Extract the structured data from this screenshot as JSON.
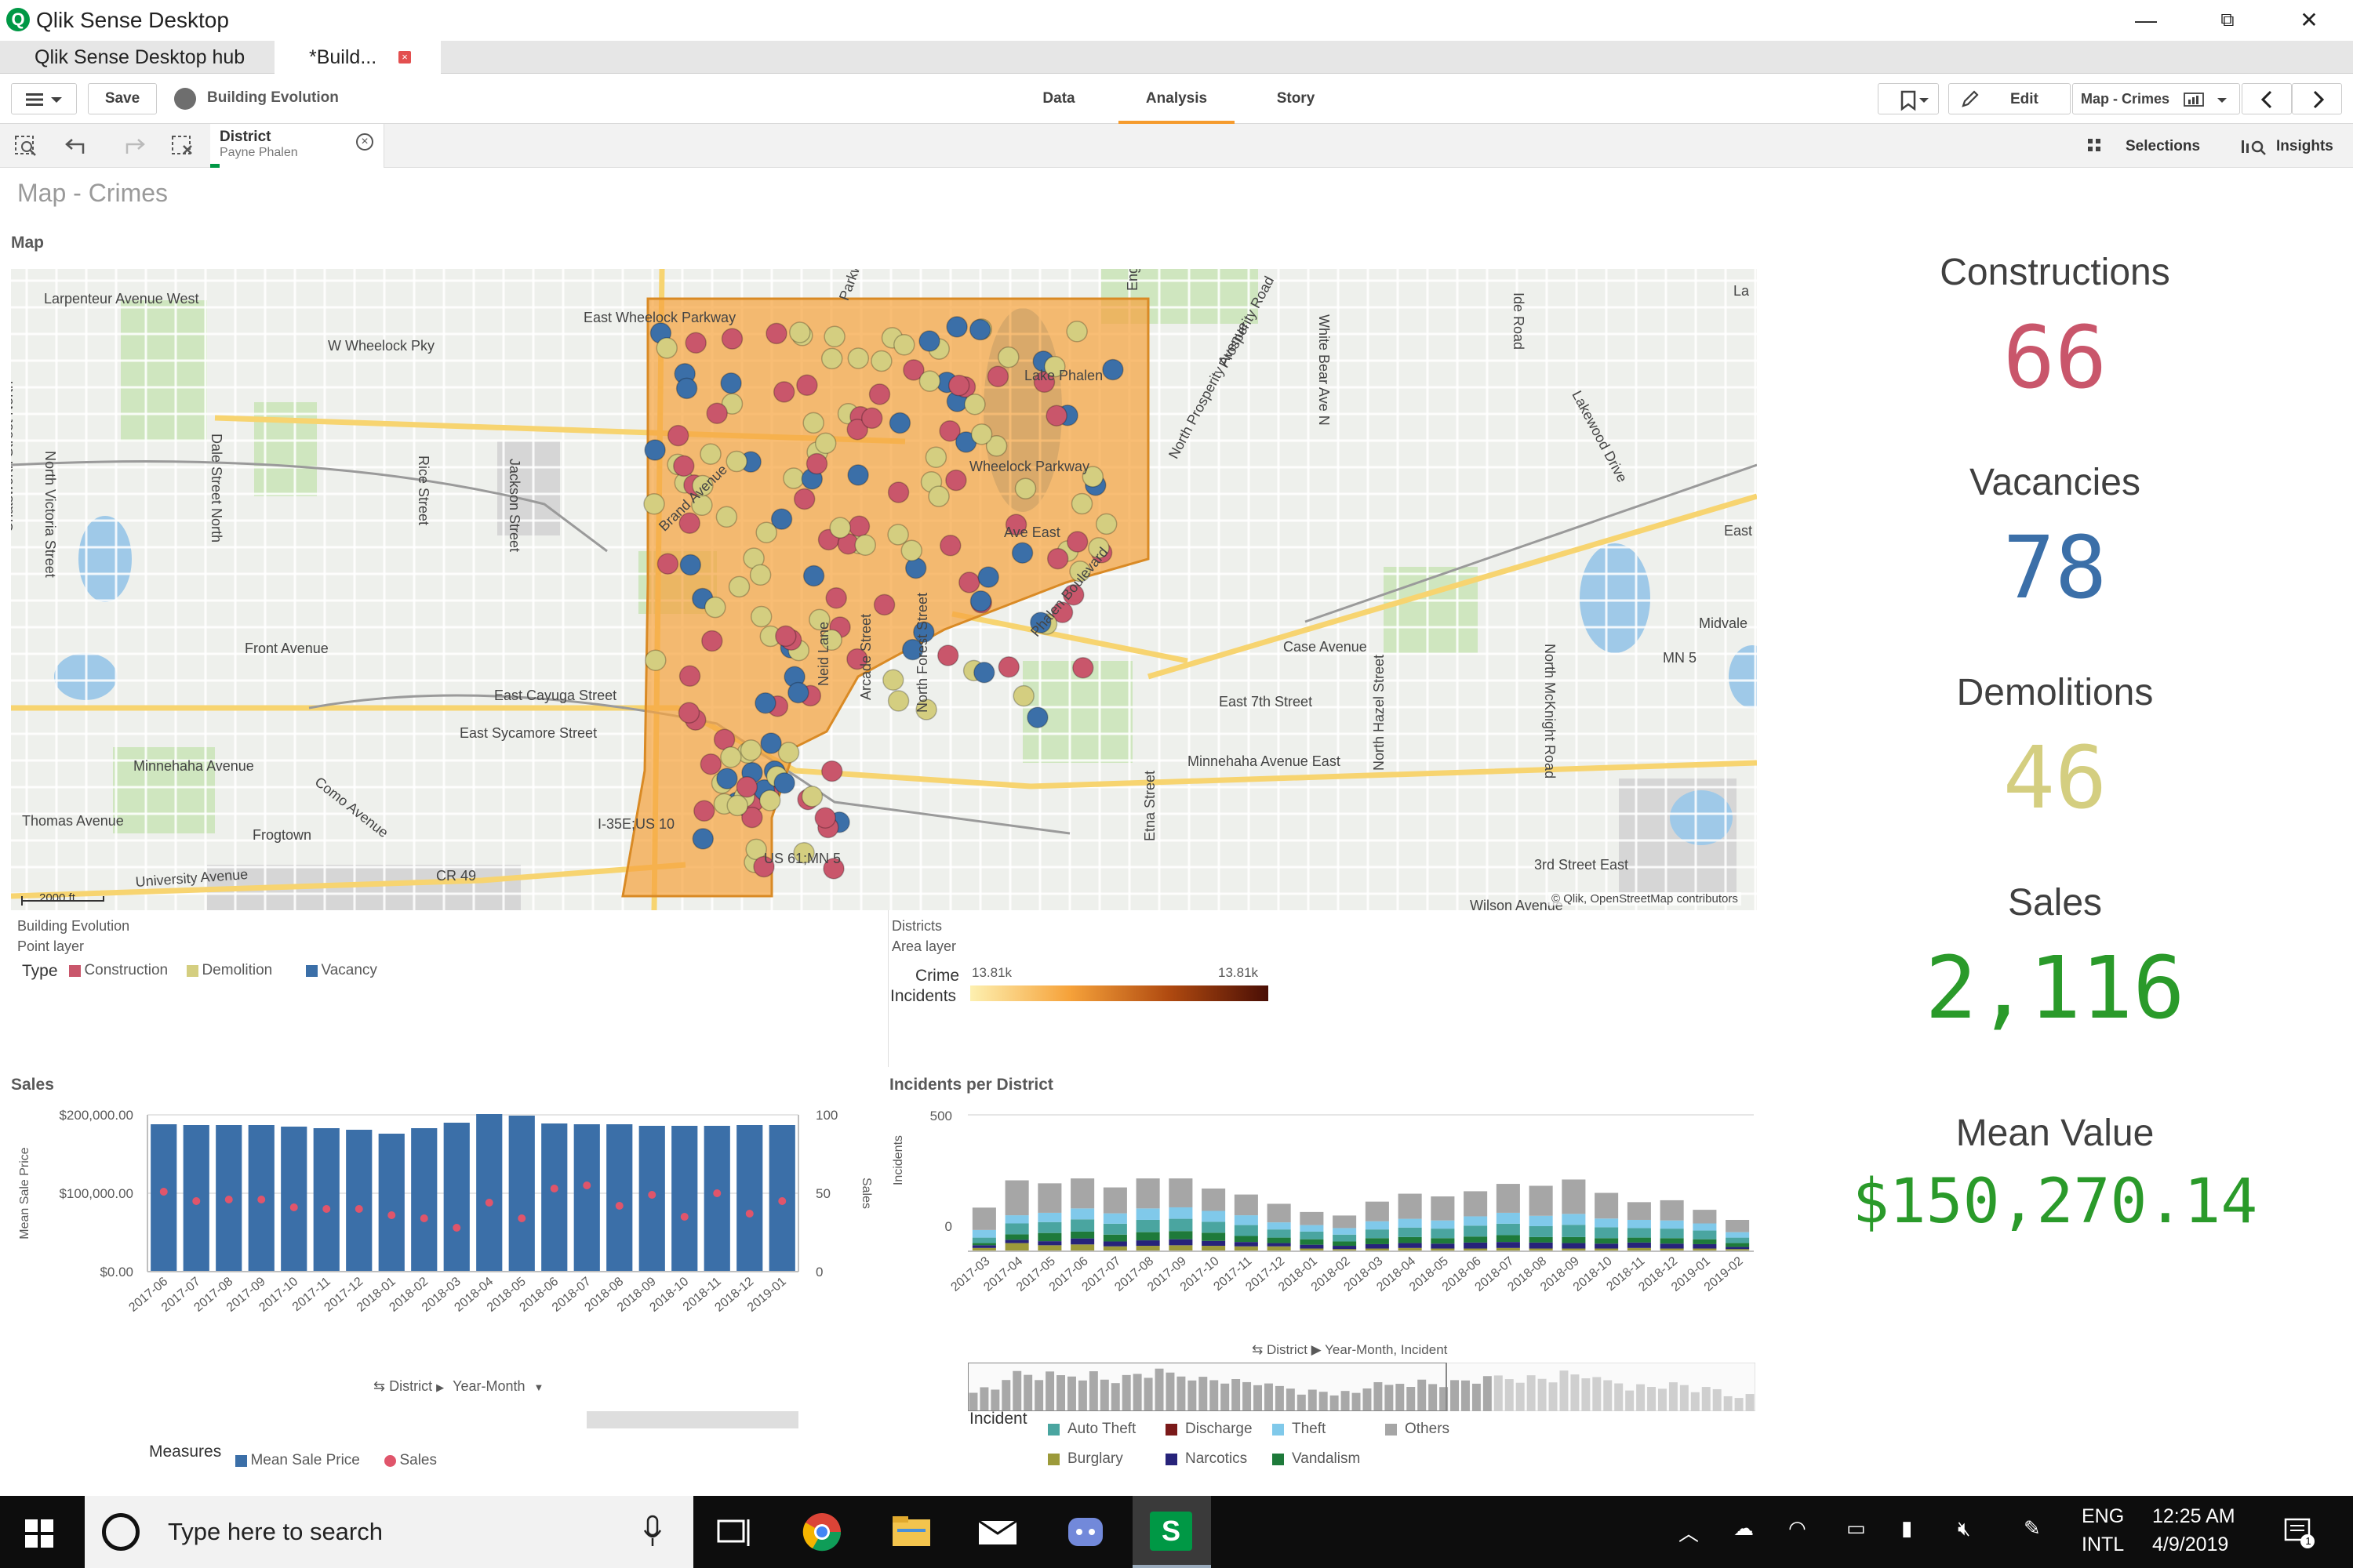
{
  "window": {
    "title": "Qlik Sense Desktop",
    "minimize": "—",
    "restore": "⧉",
    "close": "✕"
  },
  "tabs": [
    {
      "label": "Qlik Sense Desktop hub"
    },
    {
      "label": "*Build..."
    }
  ],
  "toolbar": {
    "save_label": "Save",
    "app_name": "Building Evolution",
    "nav": [
      "Data",
      "Analysis",
      "Story"
    ],
    "edit_label": "Edit",
    "sheet_name": "Map - Crimes"
  },
  "selections_bar": {
    "chip": {
      "field": "District",
      "value": "Payne Phalen"
    },
    "selections_label": "Selections",
    "insights_label": "Insights"
  },
  "sheet": {
    "title": "Map - Crimes"
  },
  "map": {
    "label": "Map",
    "scale_label": "2000 ft",
    "attribution": "© Qlik, OpenStreetMap contributors",
    "street_labels": [
      "Larpenteur Avenue West",
      "W Wheelock Pky",
      "East Wheelock Parkway",
      "Wheelock Parkway",
      "Lake Phalen",
      "Prosperity Road",
      "North Prosperity Avenue",
      "White Bear Ave N",
      "Ide Road",
      "Lakewood Drive",
      "North Victoria Street",
      "Dale Street North",
      "Rice Street",
      "Jackson Street",
      "Chatsworth Street North",
      "Front Avenue",
      "East Cayuga Street",
      "East Sycamore Street",
      "Como Avenue",
      "Minnehaha Avenue",
      "Thomas Avenue",
      "Frogtown",
      "University Avenue",
      "CR 49",
      "Case Avenue",
      "East 7th Street",
      "Minnehaha Avenue East",
      "North Hazel Street",
      "North McKnight Road",
      "Midvale",
      "MN 5",
      "3rd Street East",
      "Wilson Avenue",
      "Etna Street",
      "Neid Lane",
      "Arcade Street",
      "North Forest Street",
      "Phalen Boulevard",
      "Parkway D",
      "English",
      "I-35E;US 10",
      "US 61;MN 5",
      "Brand Avenue",
      "Ave East",
      "East",
      "La"
    ],
    "point_layer": {
      "title": "Building Evolution",
      "subtitle": "Point layer",
      "legend_title": "Type",
      "items": [
        {
          "label": "Construction",
          "color": "#c9566b"
        },
        {
          "label": "Demolition",
          "color": "#d4ce80"
        },
        {
          "label": "Vacancy",
          "color": "#3b6fa8"
        }
      ]
    },
    "area_layer": {
      "title": "Districts",
      "subtitle": "Area layer",
      "legend_title_1": "Crime",
      "legend_title_2": "Incidents",
      "min_label": "13.81k",
      "max_label": "13.81k"
    }
  },
  "kpis": [
    {
      "title": "Constructions",
      "value": "66",
      "color": "#c9566b"
    },
    {
      "title": "Vacancies",
      "value": "78",
      "color": "#3b6fa8"
    },
    {
      "title": "Demolitions",
      "value": "46",
      "color": "#d4ce80"
    },
    {
      "title": "Sales",
      "value": "2,116",
      "color": "#2a9a2a"
    },
    {
      "title": "Mean Value",
      "value": "$150,270.14",
      "color": "#2a9a2a"
    }
  ],
  "sales_chart": {
    "title": "Sales",
    "y_left_label": "Mean Sale Price",
    "y_right_label": "Sales",
    "y_left_ticks": [
      "$200,000.00",
      "$100,000.00",
      "$0.00"
    ],
    "y_right_ticks": [
      "100",
      "50",
      "0"
    ],
    "dimension_crumb": [
      "District",
      "Year-Month"
    ],
    "measures_label": "Measures",
    "legend": [
      {
        "label": "Mean Sale Price",
        "color": "#3b6fa8"
      },
      {
        "label": "Sales",
        "color": "#e0556b"
      }
    ]
  },
  "incidents_chart": {
    "title": "Incidents per District",
    "y_label": "Incidents",
    "y_ticks": [
      "500",
      "0"
    ],
    "crumb": "District ▶ Year-Month, Incident",
    "legend_title": "Incident",
    "legend": [
      {
        "label": "Auto Theft",
        "color": "#4aa5a0"
      },
      {
        "label": "Discharge",
        "color": "#7b1a1a"
      },
      {
        "label": "Theft",
        "color": "#80c9ea"
      },
      {
        "label": "Others",
        "color": "#a6a6a6"
      },
      {
        "label": "Burglary",
        "color": "#9c9a3a"
      },
      {
        "label": "Narcotics",
        "color": "#27237a"
      },
      {
        "label": "Vandalism",
        "color": "#1e7a3a"
      }
    ]
  },
  "chart_data": [
    {
      "type": "bar",
      "title": "Sales",
      "categories": [
        "2017-06",
        "2017-07",
        "2017-08",
        "2017-09",
        "2017-10",
        "2017-11",
        "2017-12",
        "2018-01",
        "2018-02",
        "2018-03",
        "2018-04",
        "2018-05",
        "2018-06",
        "2018-07",
        "2018-08",
        "2018-09",
        "2018-10",
        "2018-11",
        "2018-12",
        "2019-01"
      ],
      "series": [
        {
          "name": "Mean Sale Price",
          "axis": "left",
          "values": [
            188000,
            187000,
            187000,
            187000,
            185000,
            183000,
            181000,
            176000,
            183000,
            190000,
            201000,
            199000,
            189000,
            188000,
            188000,
            186000,
            186000,
            186000,
            187000,
            187000
          ]
        },
        {
          "name": "Sales",
          "axis": "right",
          "values": [
            51,
            45,
            46,
            46,
            41,
            40,
            40,
            36,
            34,
            28,
            44,
            34,
            53,
            55,
            42,
            49,
            35,
            50,
            37,
            45
          ]
        }
      ],
      "ylabel": "Mean Sale Price",
      "ylim": [
        0,
        200000
      ],
      "y2label": "Sales",
      "y2lim": [
        0,
        100
      ]
    },
    {
      "type": "bar",
      "stacked": true,
      "title": "Incidents per District",
      "categories": [
        "2017-03",
        "2017-04",
        "2017-05",
        "2017-06",
        "2017-07",
        "2017-08",
        "2017-09",
        "2017-10",
        "2017-11",
        "2017-12",
        "2018-01",
        "2018-02",
        "2018-03",
        "2018-04",
        "2018-05",
        "2018-06",
        "2018-07",
        "2018-08",
        "2018-09",
        "2018-10",
        "2018-11",
        "2018-12",
        "2019-01",
        "2019-02"
      ],
      "series": [
        {
          "name": "Burglary",
          "values": [
            12,
            30,
            22,
            25,
            18,
            20,
            22,
            20,
            18,
            18,
            10,
            8,
            10,
            12,
            10,
            10,
            12,
            10,
            10,
            10,
            12,
            10,
            10,
            8
          ]
        },
        {
          "name": "Narcotics",
          "values": [
            10,
            12,
            15,
            22,
            18,
            20,
            22,
            18,
            16,
            12,
            14,
            12,
            16,
            18,
            18,
            22,
            22,
            22,
            20,
            18,
            20,
            18,
            16,
            8
          ]
        },
        {
          "name": "Vandalism",
          "values": [
            8,
            20,
            30,
            25,
            25,
            30,
            30,
            30,
            22,
            20,
            20,
            16,
            22,
            22,
            20,
            22,
            25,
            20,
            22,
            20,
            18,
            20,
            18,
            14
          ]
        },
        {
          "name": "Auto Theft",
          "values": [
            20,
            40,
            40,
            45,
            40,
            45,
            45,
            40,
            40,
            30,
            28,
            25,
            32,
            35,
            35,
            40,
            42,
            40,
            45,
            40,
            35,
            35,
            32,
            20
          ]
        },
        {
          "name": "Theft",
          "values": [
            28,
            30,
            34,
            40,
            38,
            42,
            42,
            40,
            36,
            26,
            24,
            24,
            30,
            32,
            30,
            34,
            40,
            38,
            40,
            32,
            30,
            30,
            26,
            20
          ]
        },
        {
          "name": "Discharge",
          "values": [
            0,
            0,
            0,
            0,
            0,
            0,
            0,
            0,
            0,
            0,
            0,
            0,
            0,
            0,
            0,
            0,
            0,
            0,
            0,
            0,
            0,
            0,
            0,
            0
          ]
        },
        {
          "name": "Others",
          "values": [
            82,
            128,
            108,
            110,
            95,
            110,
            106,
            82,
            76,
            68,
            48,
            46,
            72,
            92,
            88,
            92,
            106,
            110,
            126,
            94,
            65,
            74,
            50,
            45
          ]
        }
      ],
      "ylabel": "Incidents",
      "ylim": [
        0,
        500
      ]
    }
  ],
  "taskbar": {
    "search_placeholder": "Type here to search",
    "lang_1": "ENG",
    "lang_2": "INTL",
    "time": "12:25 AM",
    "date": "4/9/2019",
    "notification_count": "1"
  }
}
